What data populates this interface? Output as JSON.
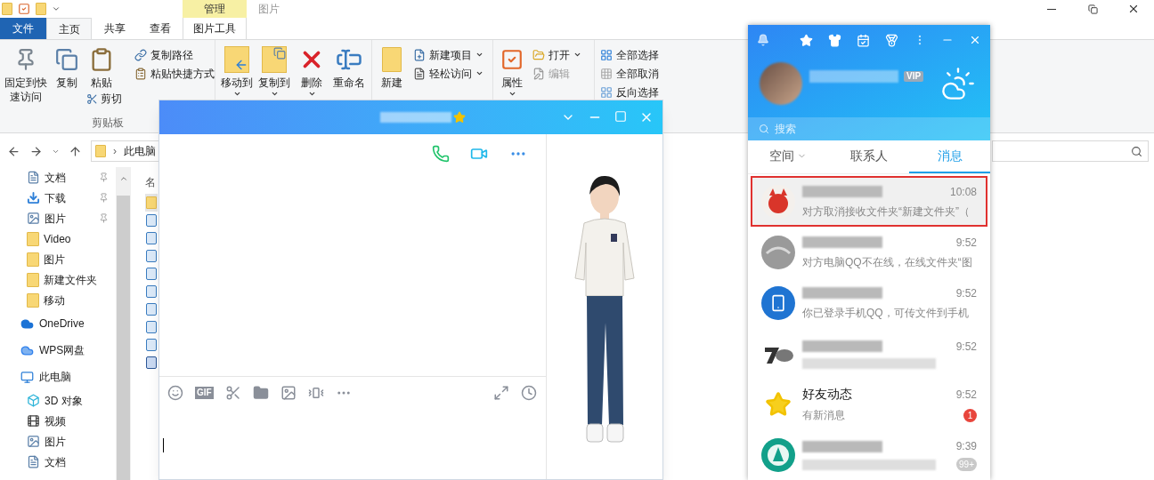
{
  "explorer": {
    "title_tabs": [
      {
        "label": "管理",
        "kind": "context"
      },
      {
        "label": "图片",
        "kind": "plain"
      }
    ],
    "ribbon_tabs": [
      {
        "label": "文件",
        "kind": "file",
        "selected": false
      },
      {
        "label": "主页",
        "kind": "tab",
        "selected": true
      },
      {
        "label": "共享",
        "kind": "tab",
        "selected": false
      },
      {
        "label": "查看",
        "kind": "tab",
        "selected": false
      },
      {
        "label": "图片工具",
        "kind": "context",
        "selected": false
      }
    ],
    "clipboard": {
      "large": [
        {
          "label": "固定到快速访问",
          "kind": "pin"
        },
        {
          "label": "复制",
          "kind": "copy"
        },
        {
          "label": "粘贴",
          "kind": "paste"
        }
      ],
      "small": [
        {
          "label": "复制路径",
          "kind": "path"
        },
        {
          "label": "粘贴快捷方式",
          "kind": "shortcut"
        }
      ],
      "cut": "剪切",
      "group_label": "剪贴板"
    },
    "organize": [
      {
        "label": "移动到",
        "kind": "move",
        "dropdown": true
      },
      {
        "label": "复制到",
        "kind": "copyto",
        "dropdown": true
      },
      {
        "label": "删除",
        "kind": "delete",
        "dropdown": true
      },
      {
        "label": "重命名",
        "kind": "rename",
        "dropdown": false
      }
    ],
    "new": {
      "large": "新建",
      "small": [
        {
          "label": "新建项目",
          "kind": "newitem",
          "dropdown": true
        },
        {
          "label": "轻松访问",
          "kind": "easy",
          "dropdown": true
        }
      ]
    },
    "open": {
      "large": "属性",
      "small": [
        {
          "label": "打开",
          "kind": "open",
          "dropdown": true,
          "disabled": false
        },
        {
          "label": "编辑",
          "kind": "edit",
          "dropdown": false,
          "disabled": true
        }
      ]
    },
    "select": [
      {
        "label": "全部选择",
        "kind": "all"
      },
      {
        "label": "全部取消",
        "kind": "none"
      },
      {
        "label": "反向选择",
        "kind": "invert"
      }
    ],
    "address": {
      "separator": "›",
      "path": "此电脑"
    },
    "nav": [
      {
        "kind": "group",
        "children": [
          {
            "label": "文档",
            "kind": "document",
            "pinned": true
          },
          {
            "label": "下载",
            "kind": "download",
            "pinned": true
          },
          {
            "label": "图片",
            "kind": "picture",
            "pinned": true
          },
          {
            "label": "Video",
            "kind": "folder",
            "pinned": false
          },
          {
            "label": "图片",
            "kind": "folder",
            "pinned": false
          },
          {
            "label": "新建文件夹",
            "kind": "folder",
            "pinned": false
          },
          {
            "label": "移动",
            "kind": "folder",
            "pinned": false
          }
        ]
      },
      {
        "label": "OneDrive",
        "kind": "onedrive",
        "pinned": false
      },
      {
        "label": "WPS网盘",
        "kind": "wps",
        "pinned": false
      },
      {
        "label": "此电脑",
        "kind": "pc",
        "pinned": false,
        "children": [
          {
            "label": "3D 对象",
            "kind": "cube",
            "pinned": false
          },
          {
            "label": "视频",
            "kind": "video",
            "pinned": false
          },
          {
            "label": "图片",
            "kind": "picture",
            "pinned": false
          },
          {
            "label": "文档",
            "kind": "document",
            "pinned": false
          }
        ]
      }
    ],
    "files": {
      "header": "名",
      "items": [
        {
          "kind": "folder",
          "selected": true
        },
        {
          "kind": "jpg",
          "selected": false
        },
        {
          "kind": "jpg",
          "selected": false
        },
        {
          "kind": "jpg",
          "selected": false
        },
        {
          "kind": "jpg",
          "selected": false
        },
        {
          "kind": "jpg",
          "selected": false
        },
        {
          "kind": "jpg",
          "selected": false
        },
        {
          "kind": "jpg",
          "selected": false
        },
        {
          "kind": "jpg",
          "selected": false
        },
        {
          "kind": "doc",
          "selected": false
        }
      ]
    }
  },
  "chat": {
    "gif_label": "GIF"
  },
  "qq": {
    "vip": "VIP",
    "search": {
      "placeholder": "搜索"
    },
    "tabs": [
      {
        "label": "空间",
        "dropdown": true,
        "selected": false
      },
      {
        "label": "联系人",
        "dropdown": false,
        "selected": false
      },
      {
        "label": "消息",
        "dropdown": false,
        "selected": true
      }
    ],
    "messages": [
      {
        "kind": "fox",
        "time": "10:08",
        "preview": "对方取消接收文件夹“新建文件夹”（",
        "selected": true
      },
      {
        "kind": "gray",
        "time": "9:52",
        "preview": "对方电脑QQ不在线，在线文件夹“图",
        "selected": false
      },
      {
        "kind": "phone",
        "time": "9:52",
        "preview": "你已登录手机QQ，可传文件到手机",
        "selected": false
      },
      {
        "kind": "logo",
        "time": "9:52",
        "selected": false
      },
      {
        "kind": "star",
        "name": "好友动态",
        "time": "9:52",
        "preview": "有新消息",
        "badge": "1",
        "color": "#e8453c",
        "selected": false
      },
      {
        "kind": "green",
        "time": "9:39",
        "badge": "99+",
        "color": "#c9c9c9",
        "selected": false
      }
    ]
  }
}
